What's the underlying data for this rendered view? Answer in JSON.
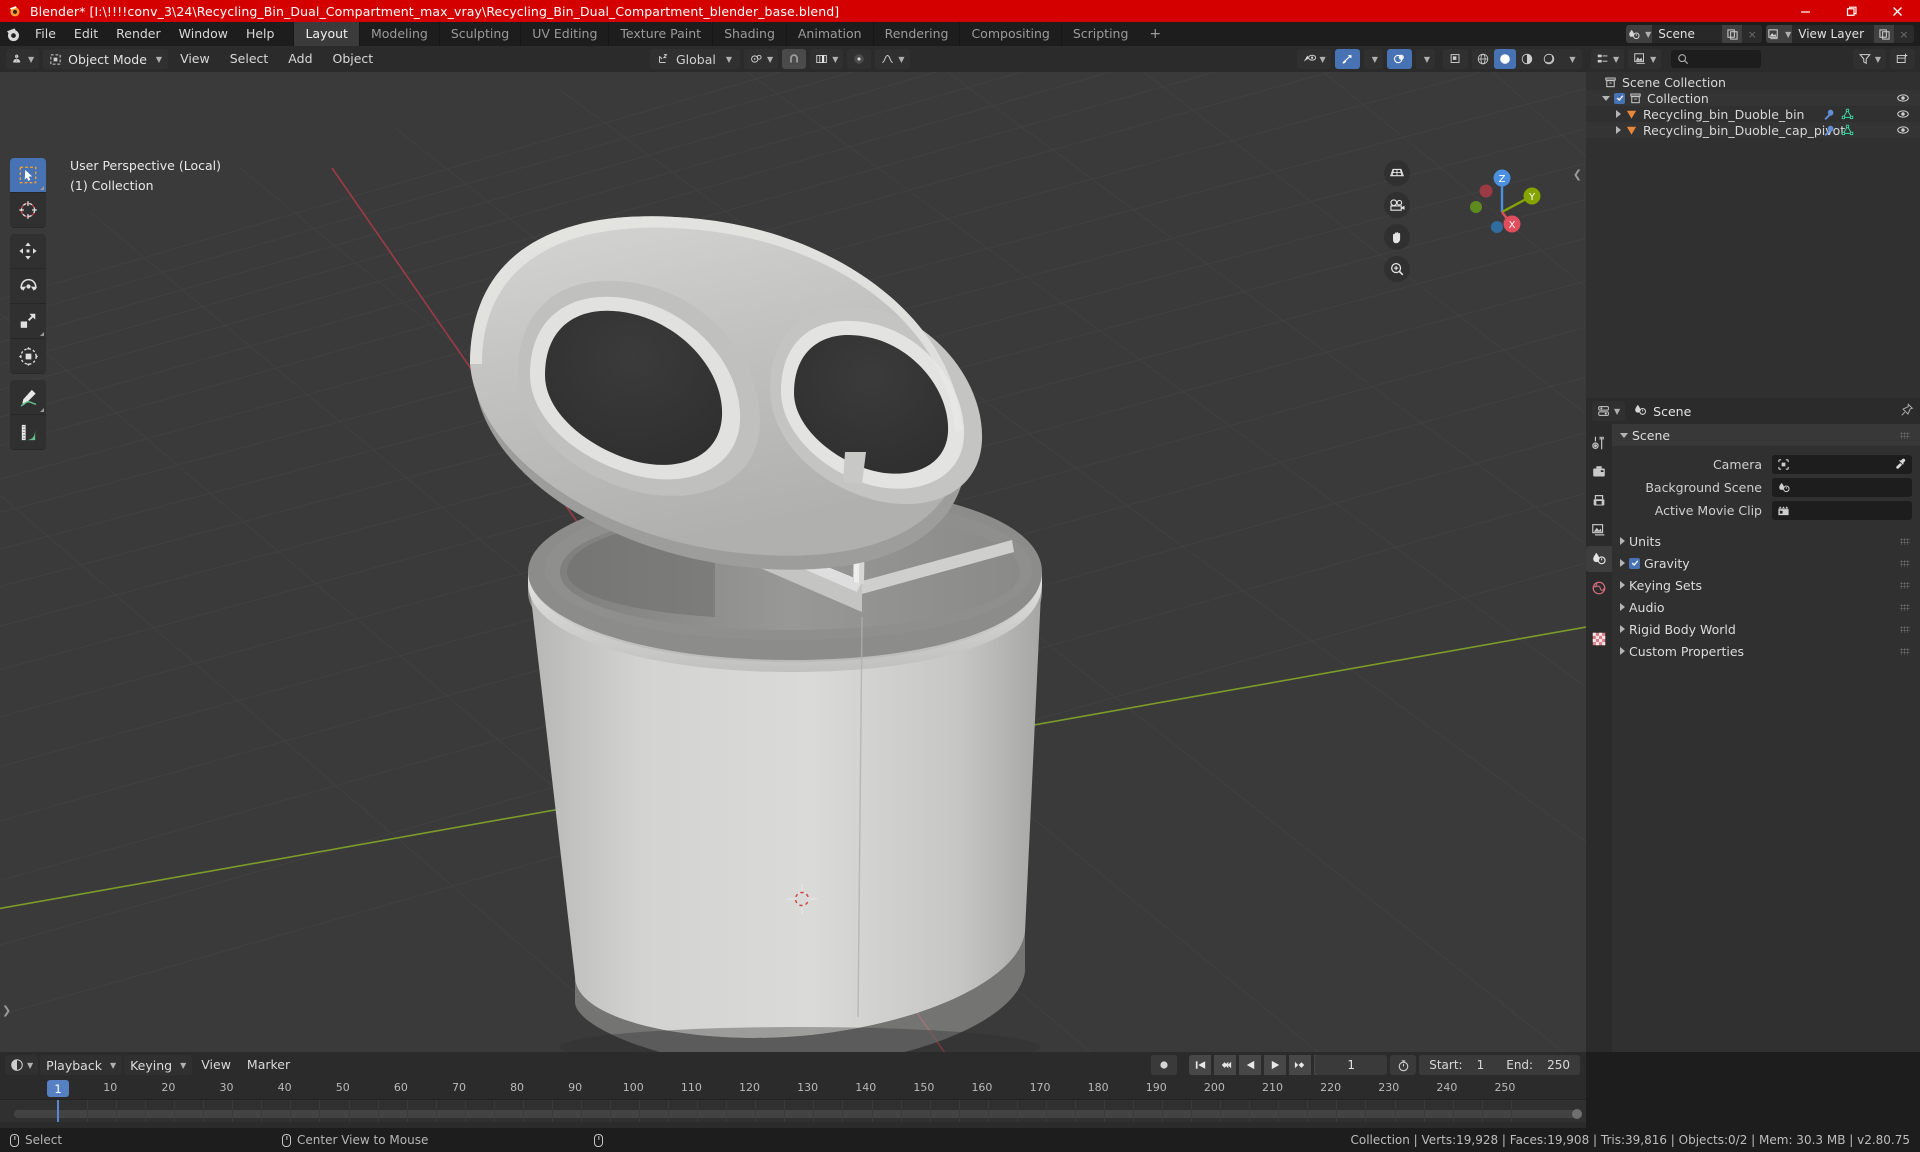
{
  "titlebar": {
    "title": "Blender* [I:\\!!!!conv_3\\24\\Recycling_Bin_Dual_Compartment_max_vray\\Recycling_Bin_Dual_Compartment_blender_base.blend]",
    "minimize": "minimize-icon",
    "maximize": "restore-icon",
    "close": "close-icon"
  },
  "topbar": {
    "logo": "blender-logo-icon",
    "menus": [
      "File",
      "Edit",
      "Render",
      "Window",
      "Help"
    ],
    "workspaces": [
      {
        "label": "Layout",
        "active": true
      },
      {
        "label": "Modeling",
        "active": false
      },
      {
        "label": "Sculpting",
        "active": false
      },
      {
        "label": "UV Editing",
        "active": false
      },
      {
        "label": "Texture Paint",
        "active": false
      },
      {
        "label": "Shading",
        "active": false
      },
      {
        "label": "Animation",
        "active": false
      },
      {
        "label": "Rendering",
        "active": false
      },
      {
        "label": "Compositing",
        "active": false
      },
      {
        "label": "Scripting",
        "active": false
      }
    ],
    "add_workspace": "+",
    "scene_datablock": {
      "icon": "scene-icon",
      "name": "Scene",
      "new": "copy-icon",
      "unlink": "×"
    },
    "viewlayer_datablock": {
      "icon": "viewlayer-icon",
      "name": "View Layer",
      "new": "copy-icon",
      "unlink": "×"
    }
  },
  "viewport_header": {
    "editor_type": "editor-type-icon",
    "mode": "Object Mode",
    "menus": [
      "View",
      "Select",
      "Add",
      "Object"
    ],
    "transform_orientation": "Global",
    "pivot_point": "pivot-icon",
    "snap": "magnet-icon",
    "snap_target": "snap-increment-icon",
    "proportional_edit": "proportional-icon",
    "falloff": "falloff-smooth-icon",
    "visibility": "show-hide-icon",
    "gizmo": "gizmo-icon",
    "overlays": "overlays-icon",
    "xray": "xray-icon",
    "shading_modes": [
      "wireframe",
      "solid",
      "material-preview",
      "rendered"
    ],
    "shading_active": "solid"
  },
  "viewport": {
    "overlay_line1": "User Perspective (Local)",
    "overlay_line2": "(1) Collection",
    "toolbar": [
      {
        "name": "tweak-select-box-tool",
        "active": true
      },
      {
        "name": "cursor-tool",
        "active": false
      },
      {
        "name": "move-tool",
        "active": false
      },
      {
        "name": "rotate-tool",
        "active": false
      },
      {
        "name": "scale-tool",
        "active": false
      },
      {
        "name": "transform-tool",
        "active": false
      },
      {
        "name": "annotate-tool",
        "active": false
      },
      {
        "name": "measure-tool",
        "active": false
      }
    ],
    "nav_buttons": [
      "toggle-camera-perspective-icon",
      "camera-view-icon",
      "move-view-icon",
      "zoom-view-icon"
    ],
    "gizmo_axes": [
      {
        "label": "Z",
        "color": "#4b8fe0"
      },
      {
        "label": "Y",
        "color": "#85a400"
      },
      {
        "label": "X",
        "color": "#e04e5e"
      }
    ]
  },
  "outliner": {
    "display_mode": "view-layer-icon",
    "filter_icon": "filter-icon",
    "new_collection_icon": "new-collection-icon",
    "search_placeholder": "",
    "rows": [
      {
        "label": "Scene Collection",
        "icon": "collection-icon",
        "indent": 0,
        "type": "scene",
        "expand": "",
        "eye": false
      },
      {
        "label": "Collection",
        "icon": "collection-icon",
        "indent": 1,
        "type": "collection",
        "expand": "down",
        "checkbox": true,
        "eye": true
      },
      {
        "label": "Recycling_bin_Duoble_bin",
        "icon": "mesh-object-icon",
        "indent": 2,
        "type": "object",
        "expand": "right",
        "modifier": true,
        "mesh": true,
        "eye": true
      },
      {
        "label": "Recycling_bin_Duoble_cap_pivot",
        "icon": "mesh-object-icon",
        "indent": 2,
        "type": "object",
        "expand": "right",
        "modifier": true,
        "mesh": true,
        "eye": true
      }
    ]
  },
  "properties": {
    "editor_icon": "properties-editor-icon",
    "breadcrumb_icon": "scene-props-icon",
    "breadcrumb": "Scene",
    "pin_icon": "pin-icon",
    "tabs": [
      {
        "name": "tool-tab",
        "active": false
      },
      {
        "name": "render-tab",
        "active": false
      },
      {
        "name": "output-tab",
        "active": false
      },
      {
        "name": "view-layer-tab",
        "active": false
      },
      {
        "name": "scene-tab",
        "active": true
      },
      {
        "name": "world-tab",
        "active": false
      },
      {
        "name": "texture-tab",
        "active": false
      }
    ],
    "panels": [
      {
        "label": "Scene",
        "open": true,
        "fields": [
          {
            "label": "Camera",
            "value": "",
            "icon": "camera-data-icon",
            "eyedropper": true
          },
          {
            "label": "Background Scene",
            "value": "",
            "icon": "scene-data-icon",
            "eyedropper": false
          },
          {
            "label": "Active Movie Clip",
            "value": "",
            "icon": "clip-data-icon",
            "eyedropper": false
          }
        ]
      },
      {
        "label": "Units",
        "open": false
      },
      {
        "label": "Gravity",
        "open": false,
        "checkbox": true
      },
      {
        "label": "Keying Sets",
        "open": false
      },
      {
        "label": "Audio",
        "open": false
      },
      {
        "label": "Rigid Body World",
        "open": false
      },
      {
        "label": "Custom Properties",
        "open": false
      }
    ]
  },
  "timeline": {
    "editor_icon": "timeline-editor-icon",
    "menus": [
      {
        "label": "Playback",
        "dropdown": true
      },
      {
        "label": "Keying",
        "dropdown": true
      },
      {
        "label": "View",
        "dropdown": false
      },
      {
        "label": "Marker",
        "dropdown": false
      }
    ],
    "record_icon": "auto-keying-icon",
    "transport": [
      "jump-to-start-icon",
      "jump-to-prev-keyframe-icon",
      "play-reverse-icon",
      "play-icon",
      "jump-to-next-keyframe-icon",
      "jump-to-end-icon"
    ],
    "current_frame": "1",
    "frame_range_icon": "use-preview-range-icon",
    "start_label": "Start:",
    "start_value": "1",
    "end_label": "End:",
    "end_value": "250",
    "ticks": [
      1,
      10,
      20,
      30,
      40,
      50,
      60,
      70,
      80,
      90,
      100,
      110,
      120,
      130,
      140,
      150,
      160,
      170,
      180,
      190,
      200,
      210,
      220,
      230,
      240,
      250
    ],
    "playhead_frame": 1
  },
  "statusbar": {
    "items": [
      {
        "icon": "mouse-left-icon",
        "label": "Select"
      },
      {
        "icon": "mouse-middle-icon",
        "label": "Center View to Mouse"
      },
      {
        "icon": "mouse-right-icon",
        "label": ""
      }
    ],
    "stats": "Collection | Verts:19,928 | Faces:19,908 | Tris:39,816 | Objects:0/2 | Mem: 30.3 MB | v2.80.75"
  },
  "colors": {
    "title_bar": "#d40000",
    "accent_blue": "#4772b3",
    "editor_bg": "#303030",
    "header_bg": "#2b2b2b",
    "viewport_bg": "#393939",
    "axis_x": "#a33c42",
    "axis_y": "#7d9e26"
  }
}
